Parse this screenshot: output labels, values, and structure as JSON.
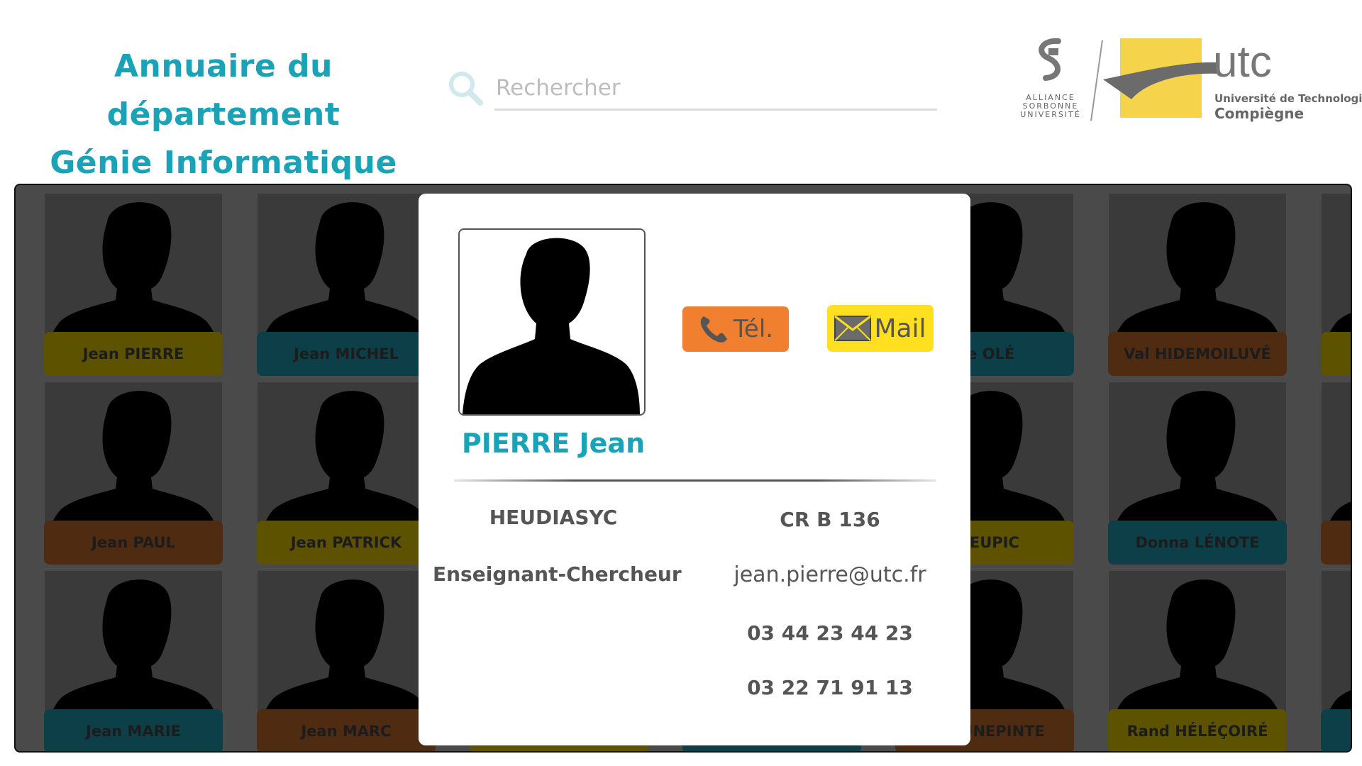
{
  "header": {
    "title_line1": "Annuaire du département",
    "title_line2": "Génie Informatique",
    "search_placeholder": "Rechercher"
  },
  "logos": {
    "sorbonne_text": [
      "ALLIANCE",
      "SORBONNE",
      "UNIVERSITÉ"
    ],
    "utc_word": "utc",
    "utc_sub1": "Université de Technologie",
    "utc_sub2": "Compiègne"
  },
  "directory": {
    "people": [
      {
        "name": "Jean PIERRE",
        "color": "yellow"
      },
      {
        "name": "Jean MICHEL",
        "color": "teal"
      },
      {
        "name": "",
        "color": "teal"
      },
      {
        "name": "",
        "color": "yellow"
      },
      {
        "name": "rie OLÉ",
        "color": "teal"
      },
      {
        "name": "Val HIDEMOILUVÉ",
        "color": "brown"
      },
      {
        "name": "",
        "color": "yellow"
      },
      {
        "name": "Jean PAUL",
        "color": "brown"
      },
      {
        "name": "Jean PATRICK",
        "color": "yellow"
      },
      {
        "name": "",
        "color": "brown"
      },
      {
        "name": "",
        "color": "teal"
      },
      {
        "name": "ÉLEUPIC",
        "color": "yellow"
      },
      {
        "name": "Donna LÉNOTE",
        "color": "teal"
      },
      {
        "name": "",
        "color": "brown"
      },
      {
        "name": "Jean MARIE",
        "color": "teal"
      },
      {
        "name": "Jean MARC",
        "color": "brown"
      },
      {
        "name": "",
        "color": "yellow"
      },
      {
        "name": "",
        "color": "teal"
      },
      {
        "name": "DAHUNEPINTE",
        "color": "brown"
      },
      {
        "name": "Rand HÉLÉÇOIRÉ",
        "color": "yellow"
      },
      {
        "name": "",
        "color": "teal"
      }
    ]
  },
  "modal": {
    "name": "PIERRE Jean",
    "tel_label": "Tél.",
    "mail_label": "Mail",
    "lab": "HEUDIASYC",
    "role": "Enseignant-Chercheur",
    "office": "CR B 136",
    "email": "jean.pierre@utc.fr",
    "phone1": "03 44 23 44 23",
    "phone2": "03 22 71 91 13"
  },
  "colors": {
    "accent": "#1aa3b6",
    "tel_button": "#f08030",
    "mail_button": "#fee021",
    "overlay_bg": "#4a4a4a"
  }
}
